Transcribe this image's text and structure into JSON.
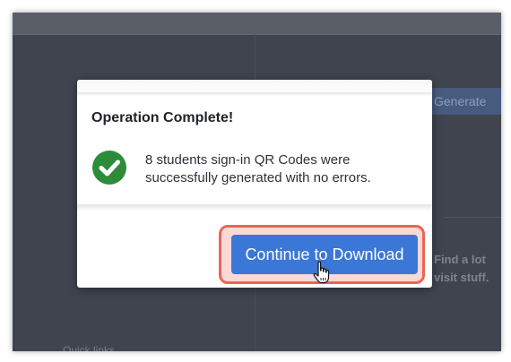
{
  "background": {
    "tab_label": "Generate",
    "text_line_1": "Find a lot",
    "text_line_2": "visit stuff.",
    "bottom_text": "Quick links"
  },
  "modal": {
    "title": "Operation Complete!",
    "message": "8 students sign-in QR Codes were successfully generated with no errors.",
    "status_icon": "check-circle-icon",
    "primary_button": {
      "label": "Continue to Download",
      "highlighted": true
    }
  },
  "colors": {
    "success_green": "#2e8b3a",
    "button_blue": "#3b77d6",
    "highlight_red": "#ea6457",
    "overlay": "#3f444e"
  }
}
